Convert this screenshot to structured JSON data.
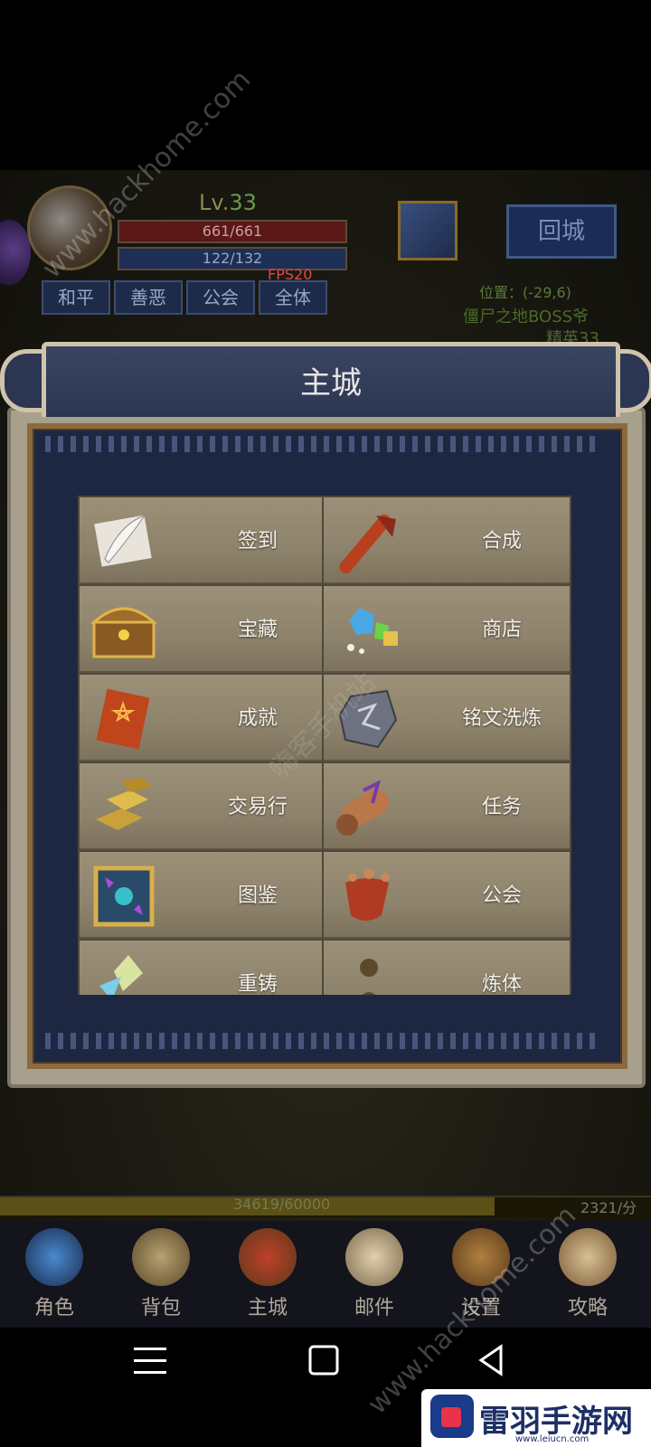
{
  "hud": {
    "level_prefix": "Lv.",
    "level_value": "33",
    "hp": "661/661",
    "mp": "122/132",
    "fps": "FPS20",
    "modes": [
      "和平",
      "善恶",
      "公会",
      "全体"
    ],
    "return_city": "回城",
    "position": "位置：(-29,6)",
    "boss_text": "僵尸之地BOSS爷",
    "partial_text": "精英33"
  },
  "modal": {
    "title": "主城",
    "items": [
      {
        "label": "签到",
        "icon": "quill-paper-icon"
      },
      {
        "label": "合成",
        "icon": "scroll-tube-icon"
      },
      {
        "label": "宝藏",
        "icon": "treasure-chest-icon"
      },
      {
        "label": "商店",
        "icon": "gems-icon"
      },
      {
        "label": "成就",
        "icon": "pentagram-scroll-icon"
      },
      {
        "label": "铭文洗炼",
        "icon": "rune-stone-icon"
      },
      {
        "label": "交易行",
        "icon": "gold-bars-icon"
      },
      {
        "label": "任务",
        "icon": "quest-scroll-icon"
      },
      {
        "label": "图鉴",
        "icon": "codex-book-icon"
      },
      {
        "label": "公会",
        "icon": "guild-banner-icon"
      },
      {
        "label": "重铸",
        "icon": "crystal-icon"
      },
      {
        "label": "炼体",
        "icon": "statue-icon"
      }
    ]
  },
  "xp": {
    "text": "34619/60000",
    "rate": "2321/分",
    "progress": 0.76
  },
  "nav": [
    {
      "label": "角色",
      "icon": "character-icon"
    },
    {
      "label": "背包",
      "icon": "bag-icon"
    },
    {
      "label": "主城",
      "icon": "city-icon"
    },
    {
      "label": "邮件",
      "icon": "mail-icon"
    },
    {
      "label": "设置",
      "icon": "gear-icon"
    },
    {
      "label": "攻略",
      "icon": "guide-scroll-icon"
    }
  ],
  "watermarks": {
    "top": "www.hackhome.com",
    "middle": "嗨客手机站",
    "bottom": "www.hackhome.com",
    "brand": "雷羽手游网",
    "brand_url": "www.leiucn.com"
  },
  "colors": {
    "panel_bg": "#1e2742",
    "cell_bg": "#9c9078",
    "hp": "#5c1717",
    "mp": "#1d2e57"
  }
}
